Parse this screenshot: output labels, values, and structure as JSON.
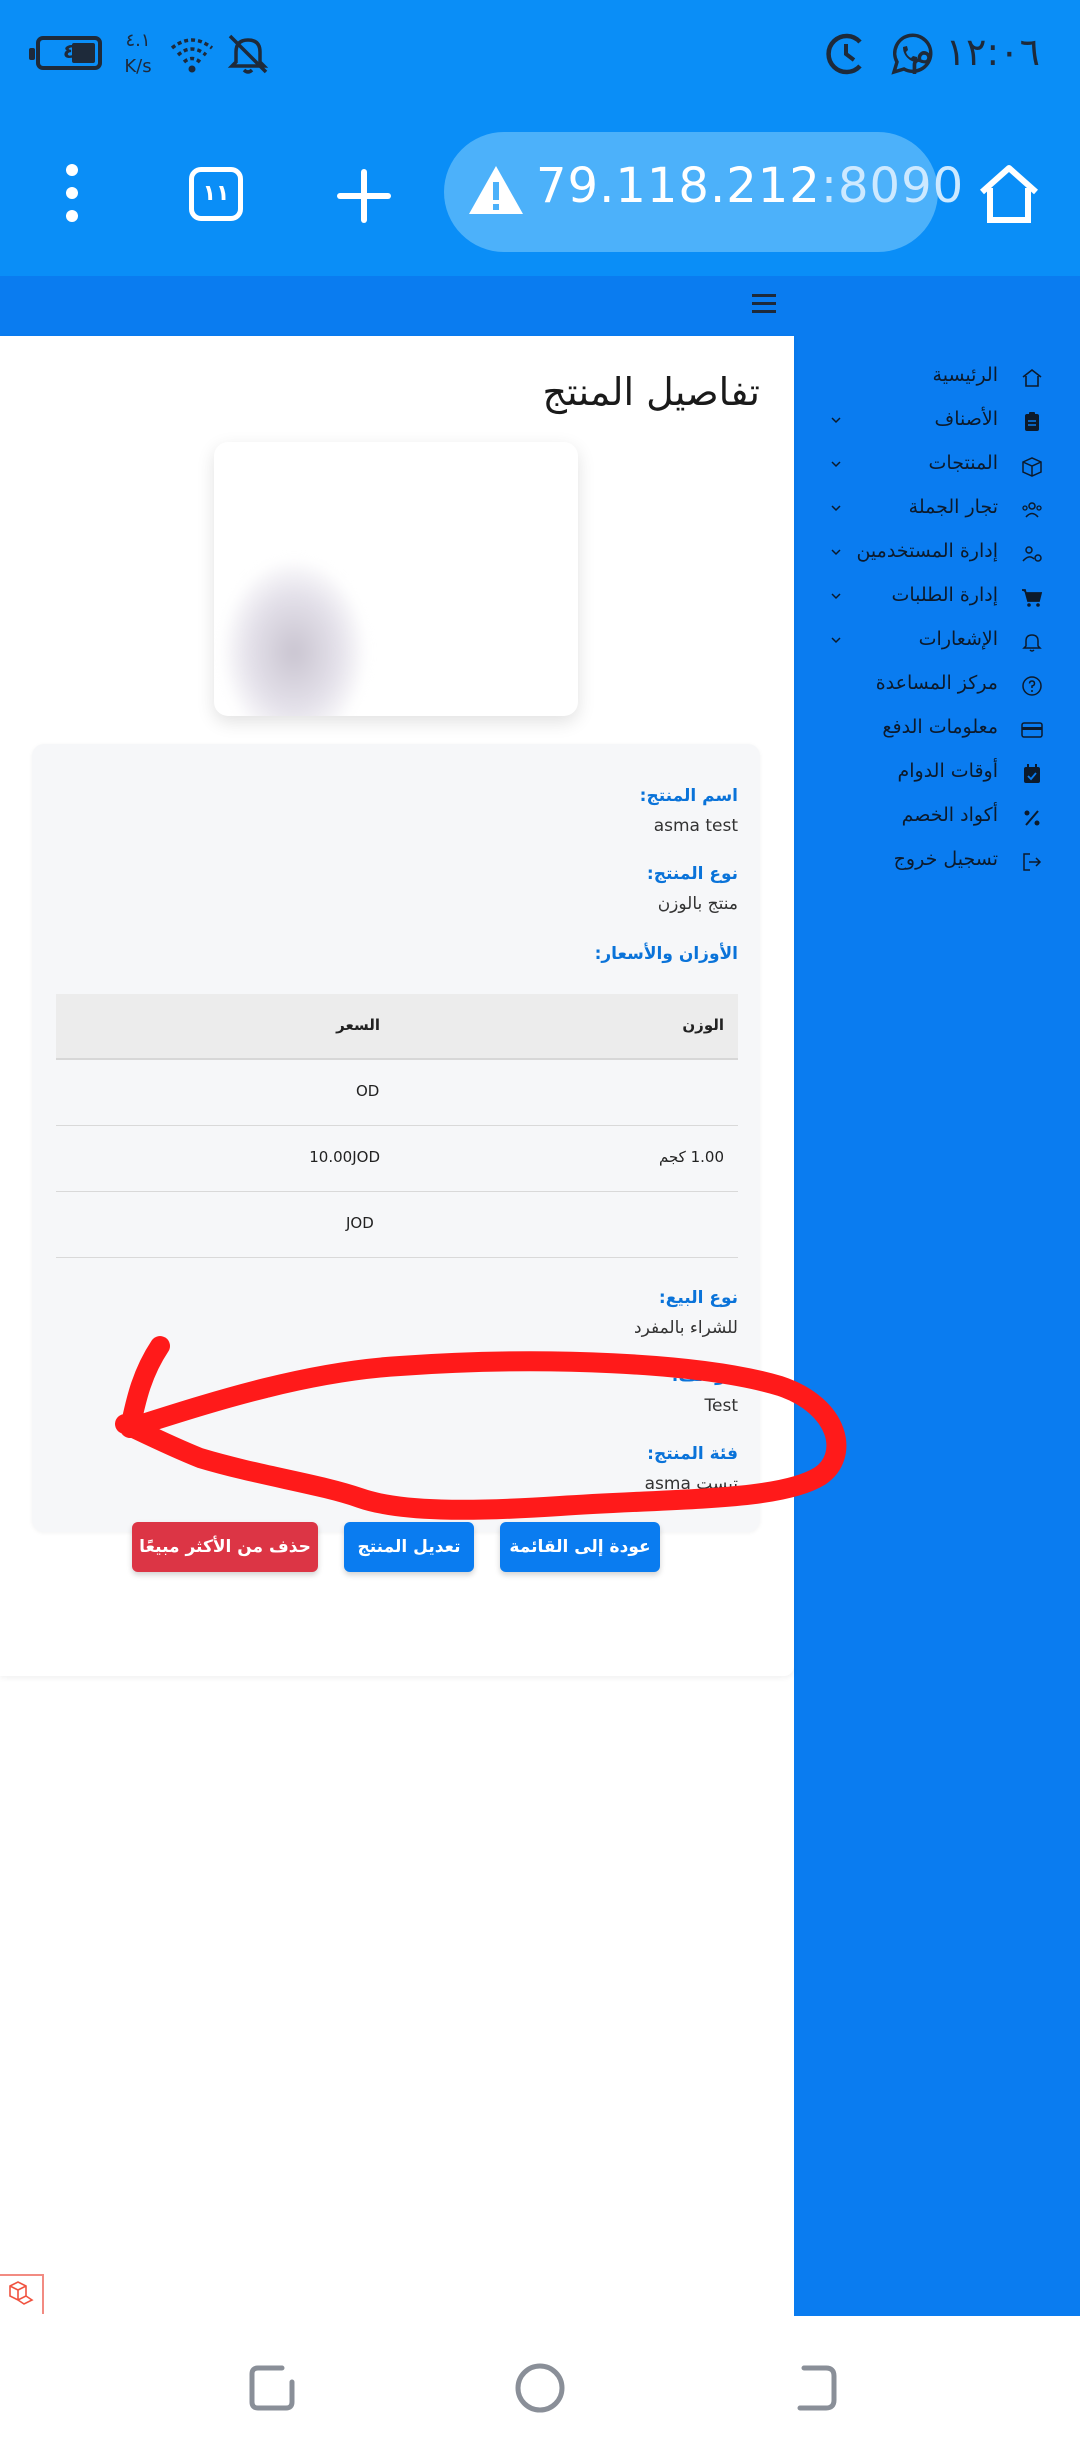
{
  "status_bar": {
    "time": "١٢:٠٦ م",
    "battery_level": "٤",
    "net_speed_value": "٤.١",
    "net_speed_unit": "K/s"
  },
  "browser": {
    "url_host": "79.118.212",
    "url_port": ":8090",
    "tab_count": "١١"
  },
  "sidebar": {
    "items": [
      {
        "label": "الرئيسية",
        "icon": "home-icon",
        "has_chevron": false
      },
      {
        "label": "الأصناف",
        "icon": "clipboard-icon",
        "has_chevron": true
      },
      {
        "label": "المنتجات",
        "icon": "box-icon",
        "has_chevron": true
      },
      {
        "label": "تجار الجملة",
        "icon": "users-icon",
        "has_chevron": true
      },
      {
        "label": "إدارة المستخدمين",
        "icon": "users-cog-icon",
        "has_chevron": true
      },
      {
        "label": "إدارة الطلبات",
        "icon": "cart-icon",
        "has_chevron": true
      },
      {
        "label": "الإشعارات",
        "icon": "bell-icon",
        "has_chevron": true
      },
      {
        "label": "مركز المساعدة",
        "icon": "question-circle-icon",
        "has_chevron": false
      },
      {
        "label": "معلومات الدفع",
        "icon": "credit-card-icon",
        "has_chevron": false
      },
      {
        "label": "أوقات الدوام",
        "icon": "calendar-icon",
        "has_chevron": false
      },
      {
        "label": "أكواد الخصم",
        "icon": "percent-icon",
        "has_chevron": false
      },
      {
        "label": "تسجيل خروج",
        "icon": "logout-icon",
        "has_chevron": false
      }
    ]
  },
  "page": {
    "title": "تفاصيل المنتج"
  },
  "details": {
    "name_label": "اسم المنتج:",
    "name_value": "asma test",
    "type_label": "نوع المنتج:",
    "type_value": "منتج بالوزن",
    "weights_label": "الأوزان والأسعار:",
    "sale_type_label": "نوع البيع:",
    "sale_type_value": "للشراء بالمفرد",
    "description_label": "الوصف:",
    "description_value": "Test",
    "category_label": "فئة المنتج:",
    "category_value": "تيست asma"
  },
  "price_table": {
    "col_weight": "الوزن",
    "col_price": "السعر",
    "row1_price_fragment": "OD",
    "row2_weight": "1.00 كجم",
    "row2_price": "10.00JOD",
    "row3_price_fragment": "JOD"
  },
  "actions": {
    "back_label": "عودة إلى القائمة",
    "edit_label": "تعديل المنتج",
    "delete_label": "حذف من الأكثر مبيعًا"
  },
  "colors": {
    "status_bar": "#0a8ef7",
    "sidebar": "#0a7cf0",
    "primary_button": "#0a7cf0",
    "danger_button": "#dc3545",
    "label_blue": "#0a73d9",
    "annotation_red": "#ff1a1a"
  }
}
